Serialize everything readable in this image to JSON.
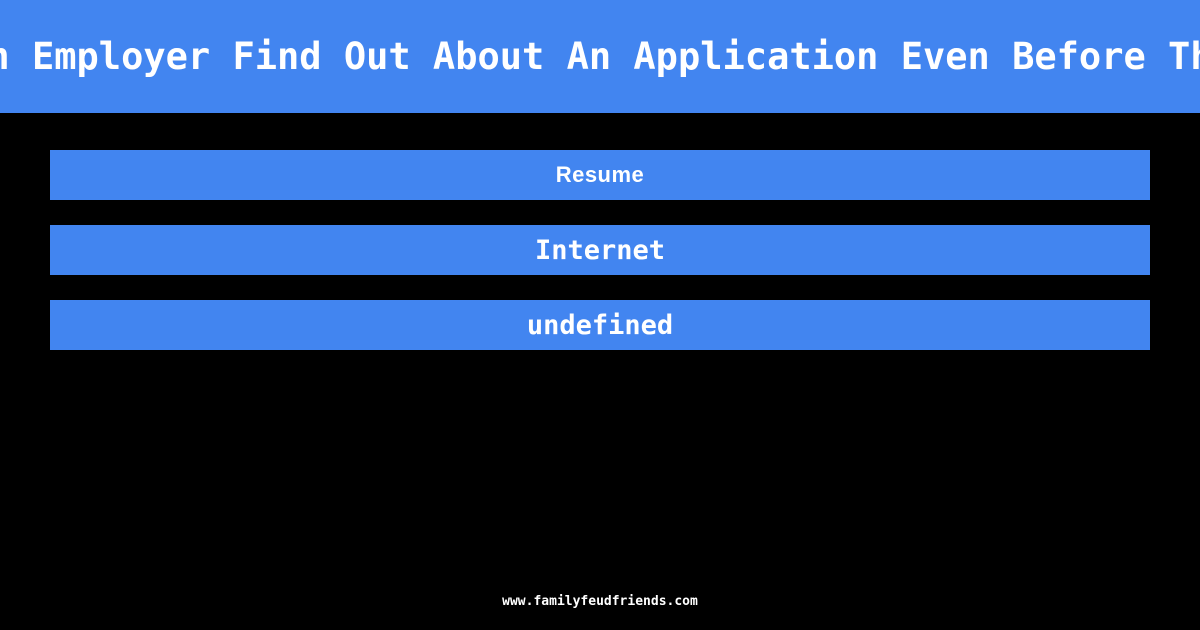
{
  "page": {
    "background_color": "#000000",
    "accent_color": "#4285f0",
    "text_color": "#ffffff"
  },
  "header": {
    "question": "How Might An Employer Find Out About An Application Even Before The Interview"
  },
  "board": {
    "answers": [
      {
        "label": "Resume"
      },
      {
        "label": "Internet"
      },
      {
        "label": "undefined"
      }
    ]
  },
  "footer": {
    "url": "www.familyfeudfriends.com"
  }
}
